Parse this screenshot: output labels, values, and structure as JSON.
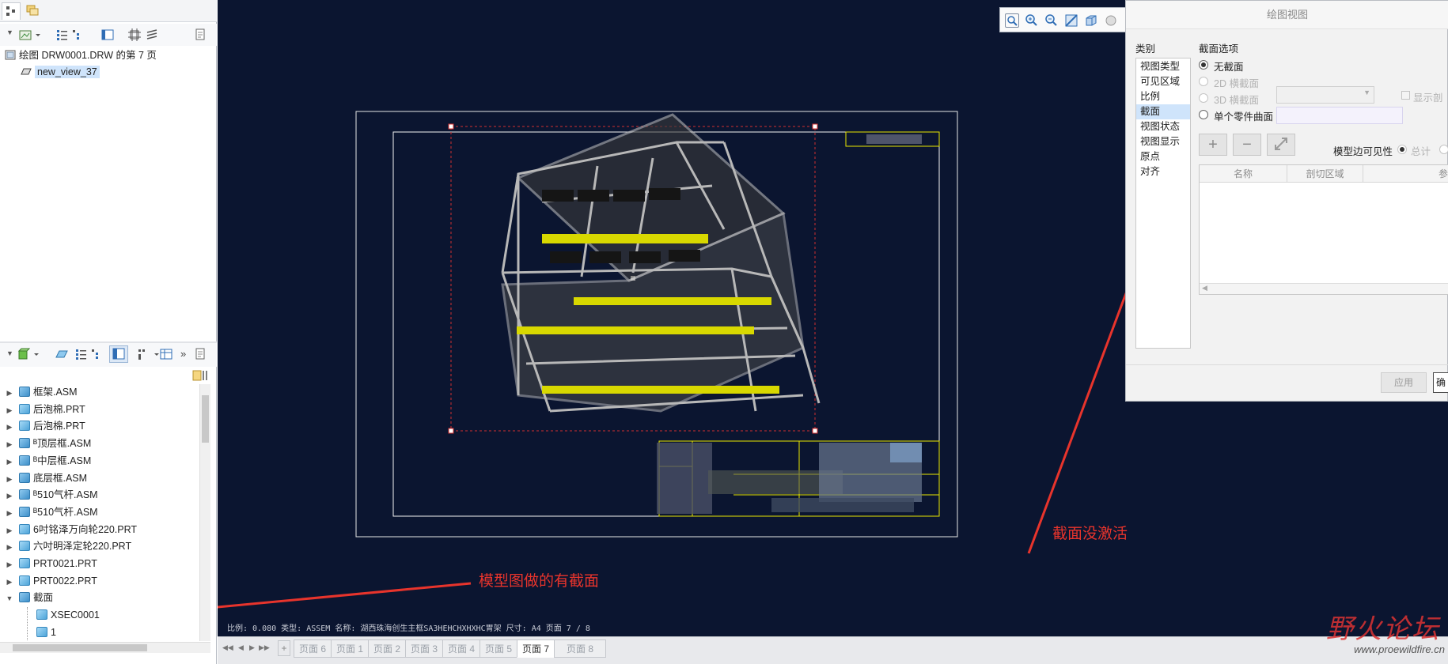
{
  "model_tree": {
    "root_label": "绘图 DRW0001.DRW 的第 7 页",
    "view_item": "new_view_37"
  },
  "assembly_tree": {
    "items": [
      {
        "label": "框架.ASM",
        "type": "asm",
        "expand": "▶"
      },
      {
        "label": "后泡棉.PRT",
        "type": "prt",
        "expand": "▶"
      },
      {
        "label": "后泡棉.PRT",
        "type": "prt",
        "expand": "▶"
      },
      {
        "label": "ᴮ顶层框.ASM",
        "type": "asm",
        "expand": "▶"
      },
      {
        "label": "ᴮ中层框.ASM",
        "type": "asm",
        "expand": "▶"
      },
      {
        "label": "底层框.ASM",
        "type": "asm",
        "expand": "▶"
      },
      {
        "label": "ᴮ510气杆.ASM",
        "type": "asm",
        "expand": "▶"
      },
      {
        "label": "ᴮ510气杆.ASM",
        "type": "asm",
        "expand": "▶"
      },
      {
        "label": "6吋铭泽万向轮220.PRT",
        "type": "prt",
        "expand": "▶"
      },
      {
        "label": "六吋明泽定轮220.PRT",
        "type": "prt",
        "expand": "▶"
      },
      {
        "label": "PRT0021.PRT",
        "type": "prt",
        "expand": "▶"
      },
      {
        "label": "PRT0022.PRT",
        "type": "prt",
        "expand": "▶"
      },
      {
        "label": "截面",
        "type": "folder",
        "expand": "▼"
      }
    ],
    "sub_items": [
      "XSEC0001",
      "1"
    ]
  },
  "canvas": {
    "status_line": "比例: 0.080    类型: ASSEM    名称: 湖西珠海创生主框SA3HEHCHXHXHC胃架    尺寸: A4    页面 7 / 8"
  },
  "dialog": {
    "title": "绘图视图",
    "category_header": "类别",
    "categories": [
      "视图类型",
      "可见区域",
      "比例",
      "截面",
      "视图状态",
      "视图显示",
      "原点",
      "对齐"
    ],
    "selected_category": "截面",
    "section_options_header": "截面选项",
    "options": {
      "none": "无截面",
      "2d": "2D 横截面",
      "3d": "3D 横截面",
      "single_surface": "单个零件曲面"
    },
    "show_label": "显示剖",
    "edge_visibility_label": "模型边可见性",
    "edge_total": "总计",
    "columns": [
      "名称",
      "剖切区域",
      "参"
    ],
    "apply": "应用",
    "confirm": "确"
  },
  "page_tabs": [
    "页面 6",
    "页面 1",
    "页面 2",
    "页面 3",
    "页面 4",
    "页面 5",
    "页面 7",
    "页面 8"
  ],
  "active_page": "页面 7",
  "annotations": {
    "left": "模型图做的有截面",
    "right": "截面没激活"
  },
  "watermark": {
    "title": "野火论坛",
    "url": "www.proewildfire.cn"
  },
  "colors": {
    "canvas_bg": "#0b1530",
    "annotation_red": "#e8342c",
    "selection_blue": "#cfe4fb"
  }
}
